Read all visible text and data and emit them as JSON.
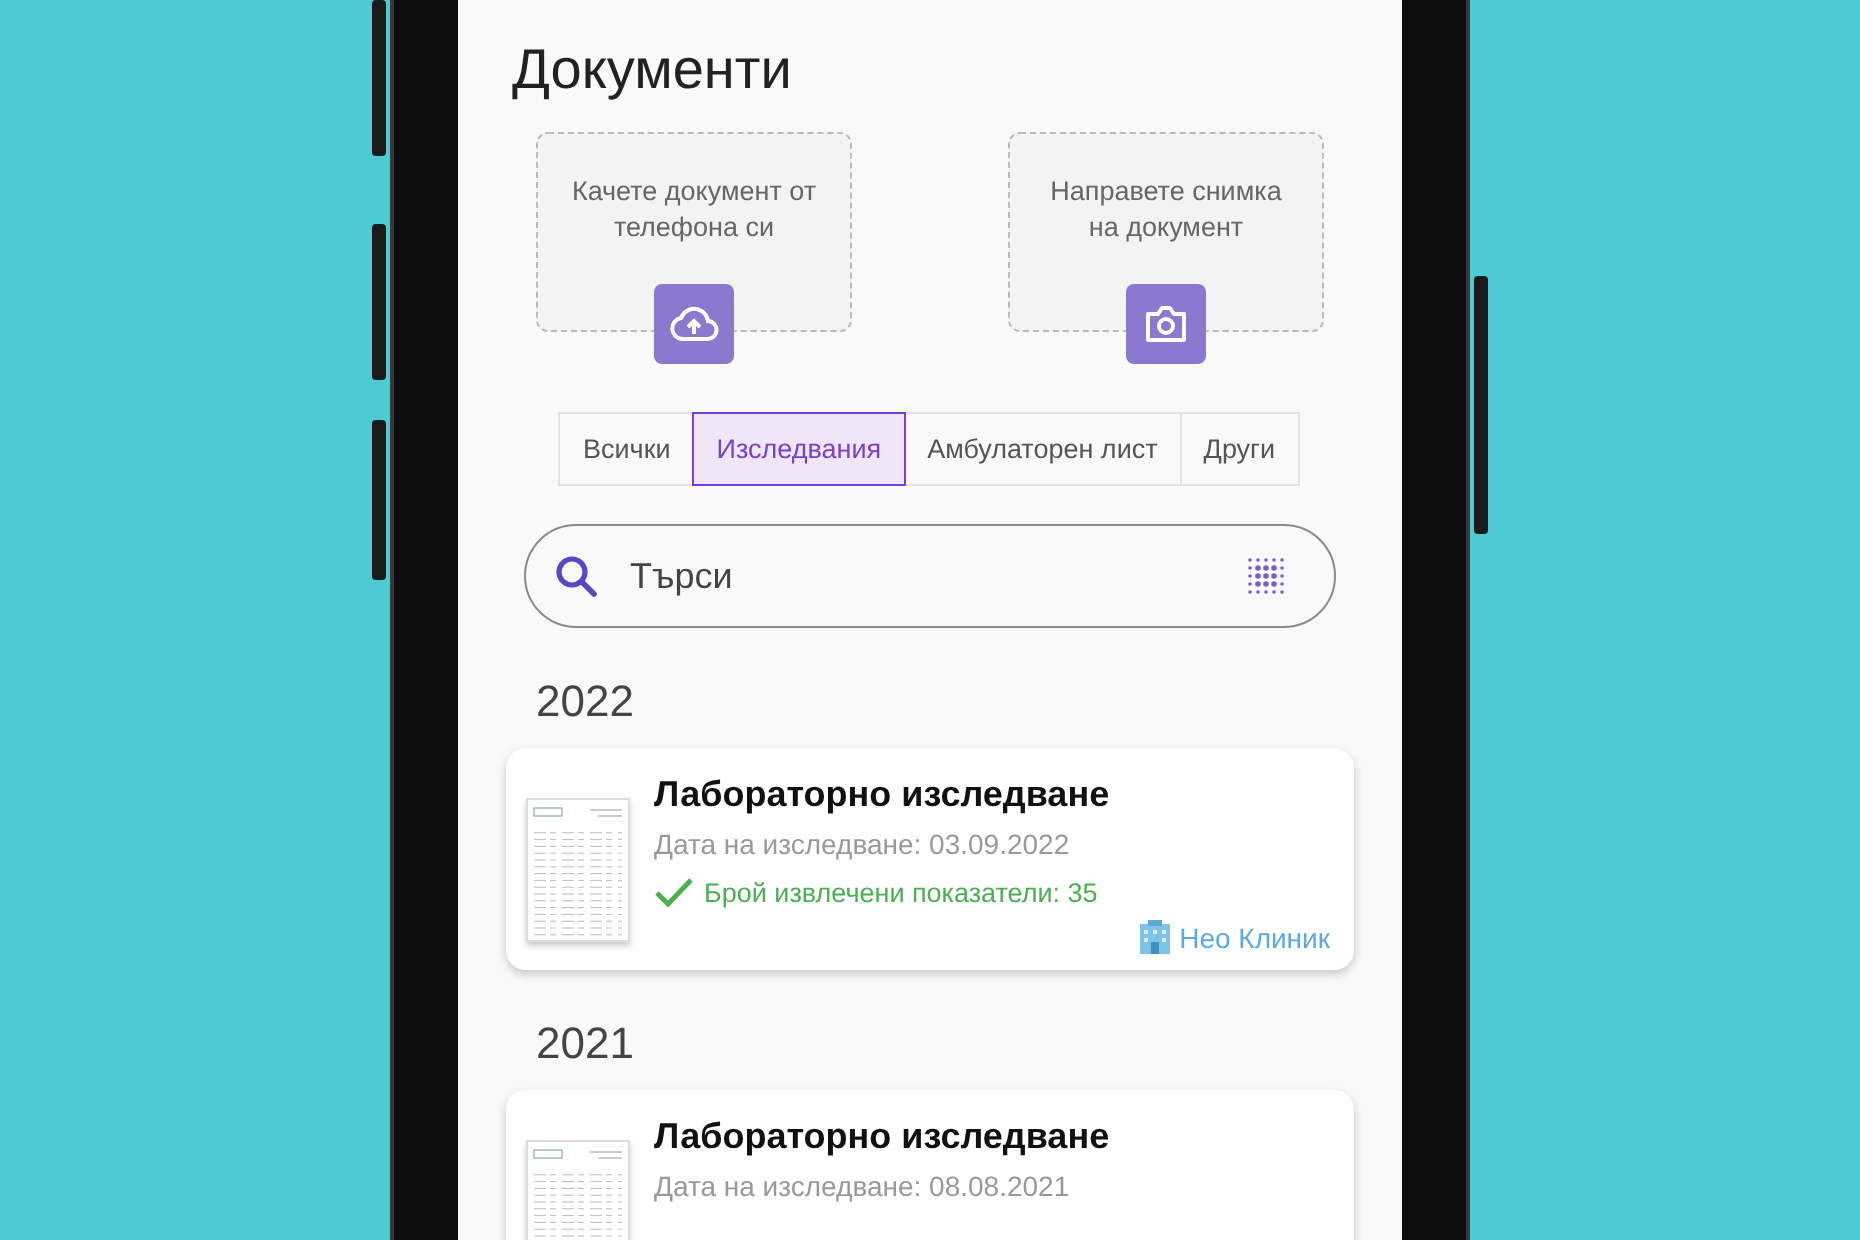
{
  "title": "Документи",
  "upload_options": [
    {
      "label": "Качете документ от телефона си",
      "kind": "upload"
    },
    {
      "label": "Направете снимка на документ",
      "kind": "camera"
    }
  ],
  "tabs": [
    {
      "label": "Всички",
      "selected": false
    },
    {
      "label": "Изследвания",
      "selected": true
    },
    {
      "label": "Амбулаторен лист",
      "selected": false
    },
    {
      "label": "Други",
      "selected": false
    }
  ],
  "search": {
    "placeholder": "Търси"
  },
  "groups": [
    {
      "year": "2022",
      "documents": [
        {
          "title": "Лабораторно изследване",
          "date": "Дата на изследване: 03.09.2022",
          "extracted": "Брой извлечени показатели: 35",
          "clinic": "Нео Клиник"
        }
      ]
    },
    {
      "year": "2021",
      "documents": [
        {
          "title": "Лабораторно изследване",
          "date": "Дата на изследване: 08.08.2021"
        }
      ]
    }
  ]
}
